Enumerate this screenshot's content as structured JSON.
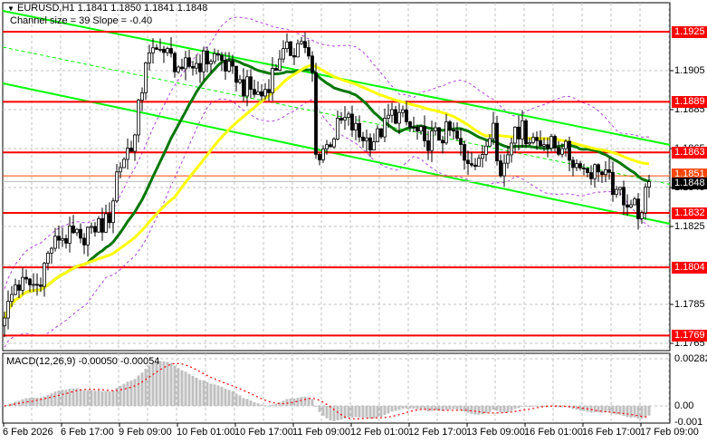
{
  "header": {
    "symbol_line": "EURUSD,H1  1.1841 1.1850 1.1841 1.1848",
    "channel_line": "Channel size = 39 Slope = -0.40"
  },
  "macd": {
    "label": "MACD(12,26,9) -0.00050 -0.00054",
    "ticks": [
      "0.00282",
      "0.00",
      "-0.001"
    ],
    "tick_values": [
      0.00282,
      0,
      -0.001
    ],
    "hist_color": "#c0c0c0",
    "signal_color": "#ff0000"
  },
  "chart_data": {
    "type": "candlestick",
    "title": "EURUSD,H1",
    "ohlc_last": {
      "open": 1.1841,
      "high": 1.185,
      "low": 1.1841,
      "close": 1.1848
    },
    "ylim": [
      1.1762,
      1.1936
    ],
    "y_ticks": [
      "1.1905",
      "1.1885",
      "1.1865",
      "1.1845",
      "1.1825",
      "1.1785",
      "1.1765"
    ],
    "y_tick_values": [
      1.1905,
      1.1885,
      1.1865,
      1.1845,
      1.1825,
      1.1785,
      1.1765
    ],
    "x_ticks": [
      "6 Feb 2026",
      "6 Feb 17:00",
      "9 Feb 09:00",
      "10 Feb 01:00",
      "10 Feb 17:00",
      "11 Feb 09:00",
      "12 Feb 01:00",
      "12 Feb 17:00",
      "13 Feb 09:00",
      "16 Feb 01:00",
      "16 Feb 17:00",
      "17 Feb 09:00"
    ],
    "bars_per_x_tick": 16,
    "bar_count": 179,
    "close_keypoints": [
      [
        0,
        1.1778
      ],
      [
        3,
        1.1795
      ],
      [
        9,
        1.1795
      ],
      [
        14,
        1.182
      ],
      [
        21,
        1.1819
      ],
      [
        24,
        1.1825
      ],
      [
        29,
        1.1827
      ],
      [
        31,
        1.1853
      ],
      [
        36,
        1.1872
      ],
      [
        39,
        1.1909
      ],
      [
        43,
        1.1916
      ],
      [
        49,
        1.1906
      ],
      [
        59,
        1.1913
      ],
      [
        64,
        1.1899
      ],
      [
        71,
        1.1892
      ],
      [
        76,
        1.1911
      ],
      [
        82,
        1.192
      ],
      [
        85,
        1.1904
      ],
      [
        86,
        1.1862
      ],
      [
        89,
        1.1867
      ],
      [
        94,
        1.1881
      ],
      [
        99,
        1.1869
      ],
      [
        104,
        1.1871
      ],
      [
        107,
        1.1885
      ],
      [
        112,
        1.1876
      ],
      [
        116,
        1.1869
      ],
      [
        124,
        1.1874
      ],
      [
        127,
        1.1859
      ],
      [
        132,
        1.1862
      ],
      [
        135,
        1.1878
      ],
      [
        137,
        1.1851
      ],
      [
        141,
        1.1876
      ],
      [
        149,
        1.1867
      ],
      [
        154,
        1.1865
      ],
      [
        159,
        1.1855
      ],
      [
        164,
        1.1853
      ],
      [
        169,
        1.1844
      ],
      [
        176,
        1.1832
      ],
      [
        178,
        1.1848
      ]
    ],
    "levels": [
      {
        "label": "1.1925",
        "value": 1.1925,
        "color": "#ff0000"
      },
      {
        "label": "1.1889",
        "value": 1.1889,
        "color": "#ff0000"
      },
      {
        "label": "1.1863",
        "value": 1.1863,
        "color": "#ff0000"
      },
      {
        "label": "1.1832",
        "value": 1.1832,
        "color": "#ff0000"
      },
      {
        "label": "1.1804",
        "value": 1.1804,
        "color": "#ff0000"
      },
      {
        "label": "1.1769",
        "value": 1.1769,
        "color": "#ff0000"
      }
    ],
    "ask_level": {
      "label": "1.1851",
      "value": 1.1851,
      "color": "#ff4500"
    },
    "bid_level": {
      "label": "1.1848",
      "value": 1.1848,
      "color": "#000000"
    },
    "channel": {
      "upper": [
        1.19357,
        1.18669
      ],
      "lower": [
        1.18985,
        1.18264
      ],
      "color": "#00ff00"
    },
    "moving_averages": [
      {
        "name": "fast",
        "period": 24,
        "color": "#007700"
      },
      {
        "name": "slow",
        "period": 48,
        "color": "#ffff00"
      }
    ],
    "envelope": {
      "deviation": 0.0025,
      "color": "#b040e0"
    }
  }
}
